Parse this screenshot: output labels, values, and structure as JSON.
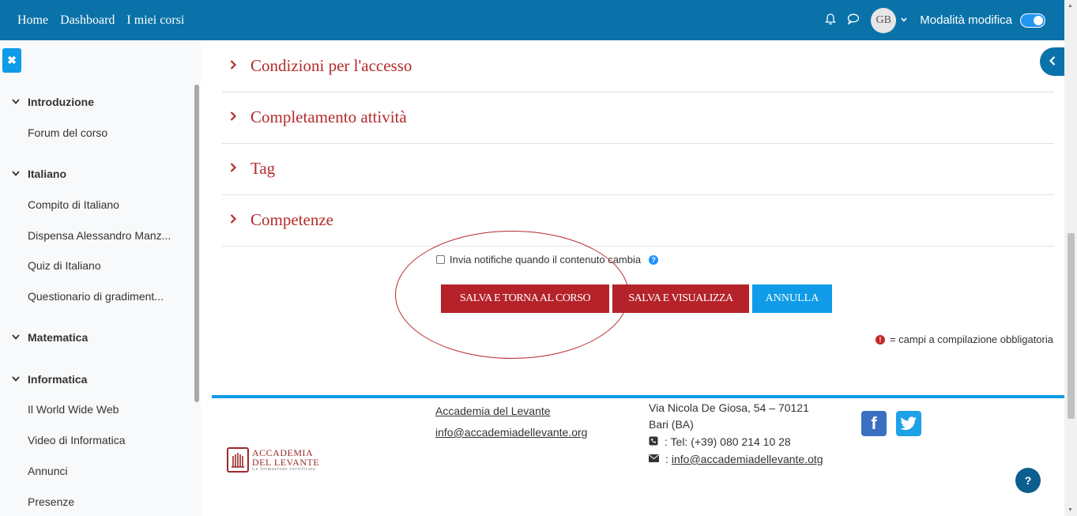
{
  "navbar": {
    "links": [
      "Home",
      "Dashboard",
      "I miei corsi"
    ],
    "avatar_initials": "GB",
    "edit_mode_label": "Modalità modifica",
    "edit_mode_on": true,
    "icons": [
      "bell-icon",
      "chat-icon",
      "chevron-down-icon"
    ]
  },
  "drawer": {
    "sections": [
      {
        "label": "Introduzione",
        "items": [
          "Forum del corso"
        ]
      },
      {
        "label": "Italiano",
        "items": [
          "Compito di Italiano",
          "Dispensa Alessandro Manz...",
          "Quiz di Italiano",
          "Questionario di gradiment..."
        ]
      },
      {
        "label": "Matematica",
        "items": []
      },
      {
        "label": "Informatica",
        "items": [
          "Il World Wide Web",
          "Video di Informatica",
          "Annunci",
          "Presenze"
        ]
      }
    ]
  },
  "main": {
    "accordions": [
      "Condizioni per l'accesso",
      "Completamento attività",
      "Tag",
      "Competenze"
    ],
    "notify_label": "Invia notifiche quando il contenuto cambia",
    "notify_checked": false,
    "buttons": {
      "save_return": "SALVA E TORNA AL CORSO",
      "save_view": "SALVA E VISUALIZZA",
      "cancel": "ANNULLA"
    },
    "required_note": "= campi a compilazione obbligatoria"
  },
  "footer": {
    "logo": {
      "line1": "ACCADEMIA",
      "line2": "DEL LEVANTE",
      "line3": "La formazione certificata"
    },
    "org_link": "Accademia del Levante",
    "email_link": "info@accademiadellevante.org",
    "address": "Via Nicola De Giosa, 54 – 70121 Bari (BA)",
    "phone": ": Tel: (+39) 080 214 10 28",
    "email_prefix": ":",
    "email2": "info@accademiadellevante.otg"
  },
  "colors": {
    "navbar": "#0a72a8",
    "accent_red": "#b5222a",
    "accent_blue": "#0f9be8"
  }
}
